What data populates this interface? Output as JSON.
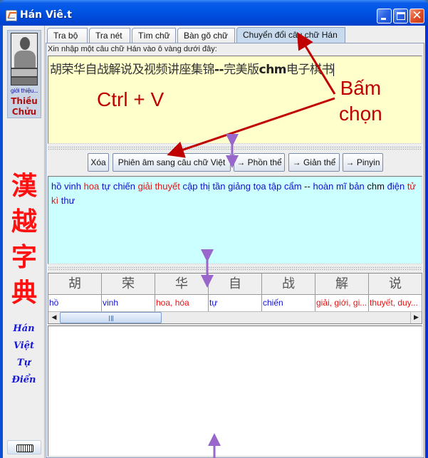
{
  "window": {
    "title": "Hán Viê.t",
    "controls": {
      "minimize": "minimize",
      "maximize": "maximize",
      "close": "close"
    }
  },
  "sidebar": {
    "portrait_caption": "giới thiệu...",
    "portrait_name_line1": "Thiều",
    "portrait_name_line2": "Chửu",
    "han_chars": [
      "漢",
      "越",
      "字",
      "典"
    ],
    "viet_words": [
      "Hán",
      "Việt",
      "Tự",
      "Điển"
    ],
    "keyboard_icon": "keyboard-icon"
  },
  "tabs": [
    {
      "label": "Tra bộ",
      "active": false
    },
    {
      "label": "Tra nét",
      "active": false
    },
    {
      "label": "Tìm chữ",
      "active": false
    },
    {
      "label": "Bàn gõ chữ",
      "active": false
    },
    {
      "label": "Chuyển đổi câu chữ Hán",
      "active": true
    }
  ],
  "converter": {
    "prompt": "Xin nhập một câu chữ Hán vào ô vàng dưới đây:",
    "input_parts": [
      {
        "text": "胡荣华自战解说及视频讲座集锦",
        "latin": false
      },
      {
        "text": "--",
        "latin": true
      },
      {
        "text": "完美版",
        "latin": false
      },
      {
        "text": "chm",
        "latin": true
      },
      {
        "text": "电子棋书",
        "latin": false
      }
    ],
    "buttons": {
      "clear": "Xóa",
      "transcribe": "Phiên âm sang câu chữ Việt",
      "traditional": "→ Phồn thể",
      "simplified": "→ Giản thể",
      "pinyin": "→ Pinyin"
    },
    "result_words": [
      {
        "text": "hồ",
        "color": "blue"
      },
      {
        "text": "vinh",
        "color": "blue"
      },
      {
        "text": "hoa",
        "color": "red"
      },
      {
        "text": "tự",
        "color": "blue"
      },
      {
        "text": "chiến",
        "color": "blue"
      },
      {
        "text": "giải",
        "color": "red"
      },
      {
        "text": "thuyết",
        "color": "red"
      },
      {
        "text": "cập",
        "color": "blue"
      },
      {
        "text": "thị",
        "color": "blue"
      },
      {
        "text": "tần",
        "color": "blue"
      },
      {
        "text": "giảng",
        "color": "blue"
      },
      {
        "text": "tọa",
        "color": "blue"
      },
      {
        "text": "tập",
        "color": "blue"
      },
      {
        "text": "cẩm",
        "color": "blue"
      },
      {
        "text": "--",
        "color": "black"
      },
      {
        "text": "hoàn",
        "color": "blue"
      },
      {
        "text": "mĩ",
        "color": "blue"
      },
      {
        "text": "bản",
        "color": "blue"
      },
      {
        "text": "chm",
        "color": "black"
      },
      {
        "text": "điện",
        "color": "blue"
      },
      {
        "text": "tử",
        "color": "red"
      },
      {
        "text": "kì",
        "color": "red"
      },
      {
        "text": "thư",
        "color": "blue"
      }
    ],
    "colors": {
      "blue": "#1010cc",
      "red": "#e81010",
      "black": "#111111",
      "input_bg": "#ffffcc",
      "result_bg": "#ccffff"
    },
    "table": {
      "headers": [
        "胡",
        "荣",
        "华",
        "自",
        "战",
        "解",
        "说"
      ],
      "cells": [
        {
          "text": "hồ",
          "color": "blue"
        },
        {
          "text": "vinh",
          "color": "blue"
        },
        {
          "text": "hoa, hóa",
          "color": "red"
        },
        {
          "text": "tự",
          "color": "blue"
        },
        {
          "text": "chiến",
          "color": "blue"
        },
        {
          "text": "giải, giới, gi...",
          "color": "red"
        },
        {
          "text": "thuyết, duy...",
          "color": "red"
        }
      ],
      "scroll_left": "◀",
      "scroll_right": "▶"
    }
  },
  "annotations": {
    "ctrl_v": "Ctrl + V",
    "bam_chon_line1": "Bấm",
    "bam_chon_line2": "chọn"
  }
}
